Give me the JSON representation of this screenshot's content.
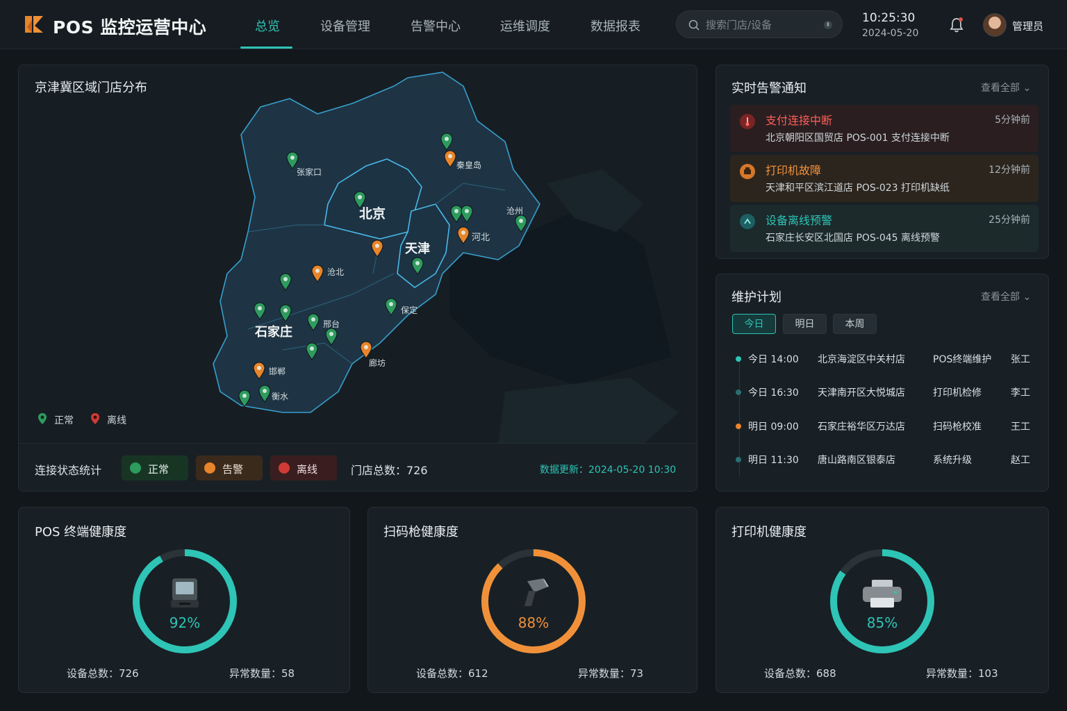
{
  "header": {
    "title": "POS 监控运营中心",
    "nav": [
      "总览",
      "设备管理",
      "告警中心",
      "运维调度",
      "数据报表"
    ],
    "active_nav": 0,
    "search_placeholder": "搜索门店/设备",
    "time": "10:25:30",
    "date": "2024-05-20",
    "user": "管理员"
  },
  "map_panel": {
    "title": "京津冀区域门店分布",
    "regions": [
      "北京",
      "天津",
      "石家庄"
    ],
    "city_labels": [
      "张家口",
      "秦皇岛",
      "河北",
      "沧州",
      "保定",
      "邢台",
      "廊坊",
      "邯郸",
      "衡水",
      "沧北"
    ],
    "legend": [
      {
        "label": "正常",
        "color": "#2e9b5e"
      },
      {
        "label": "离线",
        "color": "#d23a35"
      }
    ],
    "stats_label": "连接状态统计",
    "chips": [
      {
        "label": "正常",
        "color": "#2e9b5e"
      },
      {
        "label": "告警",
        "color": "#e8852a"
      },
      {
        "label": "离线",
        "color": "#d23a35"
      }
    ],
    "store_total_label": "门店总数：",
    "store_total": "726",
    "data_update": "数据更新：2024-05-20 10:30"
  },
  "alerts": {
    "title": "实时告警通知",
    "view_all": "查看全部",
    "items": [
      {
        "title": "支付连接中断",
        "time": "5分钟前",
        "desc": "北京朝阳区国贸店  POS-001 支付连接中断",
        "color": "#e0504a"
      },
      {
        "title": "打印机故障",
        "time": "12分钟前",
        "desc": "天津和平区滨江道店  POS-023 打印机缺纸",
        "color": "#f0913a"
      },
      {
        "title": "设备离线预警",
        "time": "25分钟前",
        "desc": "石家庄长安区北国店  POS-045 离线预警",
        "color": "#2ec4b6"
      }
    ]
  },
  "maintenance": {
    "title": "维护计划",
    "view_all": "查看全部",
    "tabs": [
      "今日",
      "明日",
      "本周"
    ],
    "active_tab": 0,
    "rows": [
      {
        "time": "今日 14:00",
        "store": "北京海淀区中关村店",
        "task": "POS终端维护",
        "person": "张工",
        "color": "#2ec4b6"
      },
      {
        "time": "今日 16:30",
        "store": "天津南开区大悦城店",
        "task": "打印机检修",
        "person": "李工",
        "color": "#2ec4b6"
      },
      {
        "time": "明日 09:00",
        "store": "石家庄裕华区万达店",
        "task": "扫码枪校准",
        "person": "王工",
        "color": "#e8852a"
      },
      {
        "time": "明日 11:30",
        "store": "唐山路南区银泰店",
        "task": "系统升级",
        "person": "赵工",
        "color": "#2ec4b6"
      }
    ]
  },
  "health": [
    {
      "title": "POS 终端健康度",
      "percent": 92,
      "percent_label": "92%",
      "color": "#2ec4b6",
      "icon": "pos-terminal-icon",
      "total_label": "设备总数：726",
      "abnormal_label": "异常数量：58"
    },
    {
      "title": "扫码枪健康度",
      "percent": 88,
      "percent_label": "88%",
      "color": "#f0913a",
      "icon": "scanner-icon",
      "total_label": "设备总数：612",
      "abnormal_label": "异常数量：73"
    },
    {
      "title": "打印机健康度",
      "percent": 85,
      "percent_label": "85%",
      "color": "#2ec4b6",
      "icon": "printer-icon",
      "total_label": "设备总数：688",
      "abnormal_label": "异常数量：103"
    }
  ]
}
